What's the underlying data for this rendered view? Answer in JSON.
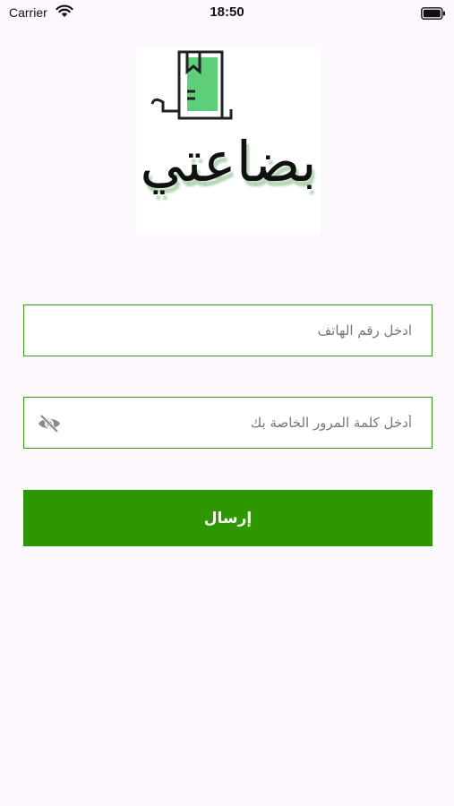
{
  "status_bar": {
    "carrier": "Carrier",
    "time": "18:50"
  },
  "logo": {
    "text": "بضاعتي",
    "accent_color": "#5fce7a"
  },
  "form": {
    "phone_placeholder": "ادخل رقم الهاتف",
    "password_placeholder": "أدخل كلمة المرور الخاصة بك",
    "submit_label": "إرسال"
  },
  "colors": {
    "primary": "#2e9600",
    "field_border": "#3a9a1a",
    "background": "#fcf8fd"
  },
  "icons": {
    "wifi": "wifi-icon",
    "battery": "battery-icon",
    "password_visibility": "eye-off-icon"
  }
}
